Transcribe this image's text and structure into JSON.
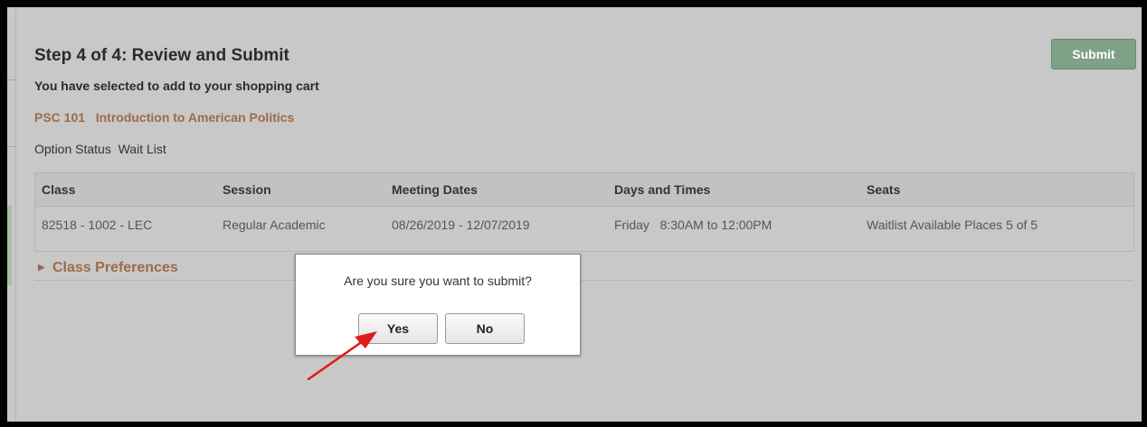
{
  "page": {
    "title": "Step 4 of 4: Review and Submit",
    "subtitle": "You have selected to add to your shopping cart",
    "submit_label": "Submit"
  },
  "course": {
    "code": "PSC 101",
    "title": "Introduction to American Politics"
  },
  "option_status": {
    "label": "Option Status",
    "value": "Wait List"
  },
  "table": {
    "headers": [
      "Class",
      "Session",
      "Meeting Dates",
      "Days and Times",
      "Seats"
    ],
    "rows": [
      [
        "82518 - 1002 - LEC",
        "Regular Academic",
        "08/26/2019 - 12/07/2019",
        "Friday   8:30AM to 12:00PM",
        "Waitlist Available Places 5 of 5"
      ]
    ]
  },
  "class_preferences": {
    "label": "Class Preferences"
  },
  "dialog": {
    "message": "Are you sure you want to submit?",
    "yes_label": "Yes",
    "no_label": "No"
  },
  "colors": {
    "overlay_background": "#c8c8c8",
    "link_brown": "#9e6a49",
    "submit_green": "#7fa187",
    "annotation_red": "#e01a1a"
  },
  "icons": {
    "collapse_toggle": "triangle-right-icon",
    "annotation": "red-arrow-icon"
  }
}
